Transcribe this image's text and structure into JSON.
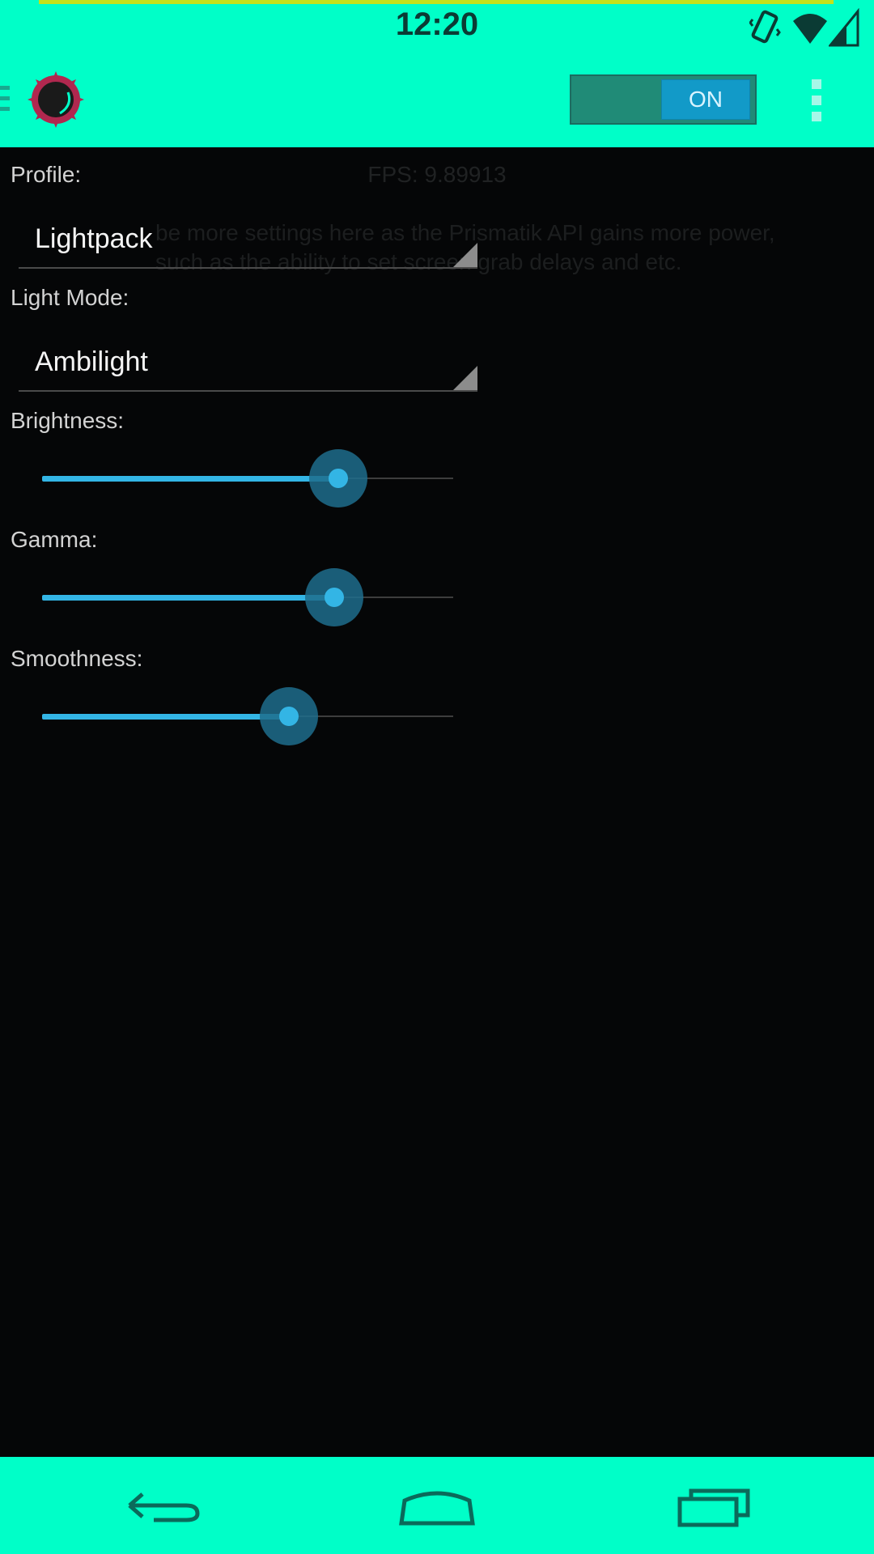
{
  "status_bar": {
    "time": "12:20",
    "icons": [
      "vibrate-icon",
      "wifi-icon",
      "cell-signal-icon"
    ],
    "notification_line_color": "#c4e21a"
  },
  "action_bar": {
    "background": "#00ffc8",
    "app_icon": "sun-gear-logo-icon",
    "toggle_label": "ON",
    "toggle_on": true,
    "menu_icon": "overflow-menu-icon"
  },
  "content": {
    "fps_text": "FPS: 9.89913",
    "note_line1": "be more settings here as the Prismatik API gains more power,",
    "note_line2": "such as the ability to set screen grab delays and etc.",
    "profile": {
      "label": "Profile:",
      "value": "Lightpack"
    },
    "light_mode": {
      "label": "Light Mode:",
      "value": "Ambilight"
    },
    "brightness": {
      "label": "Brightness:",
      "level_percent": 72
    },
    "gamma": {
      "label": "Gamma:",
      "level_percent": 71
    },
    "smoothness": {
      "label": "Smoothness:",
      "level_percent": 60
    }
  },
  "nav_bar": {
    "icons": [
      "back-icon",
      "home-icon",
      "recent-apps-icon"
    ]
  },
  "colors": {
    "accent": "#33b5e5",
    "bar_background": "#00ffc8",
    "content_background": "#050607"
  }
}
